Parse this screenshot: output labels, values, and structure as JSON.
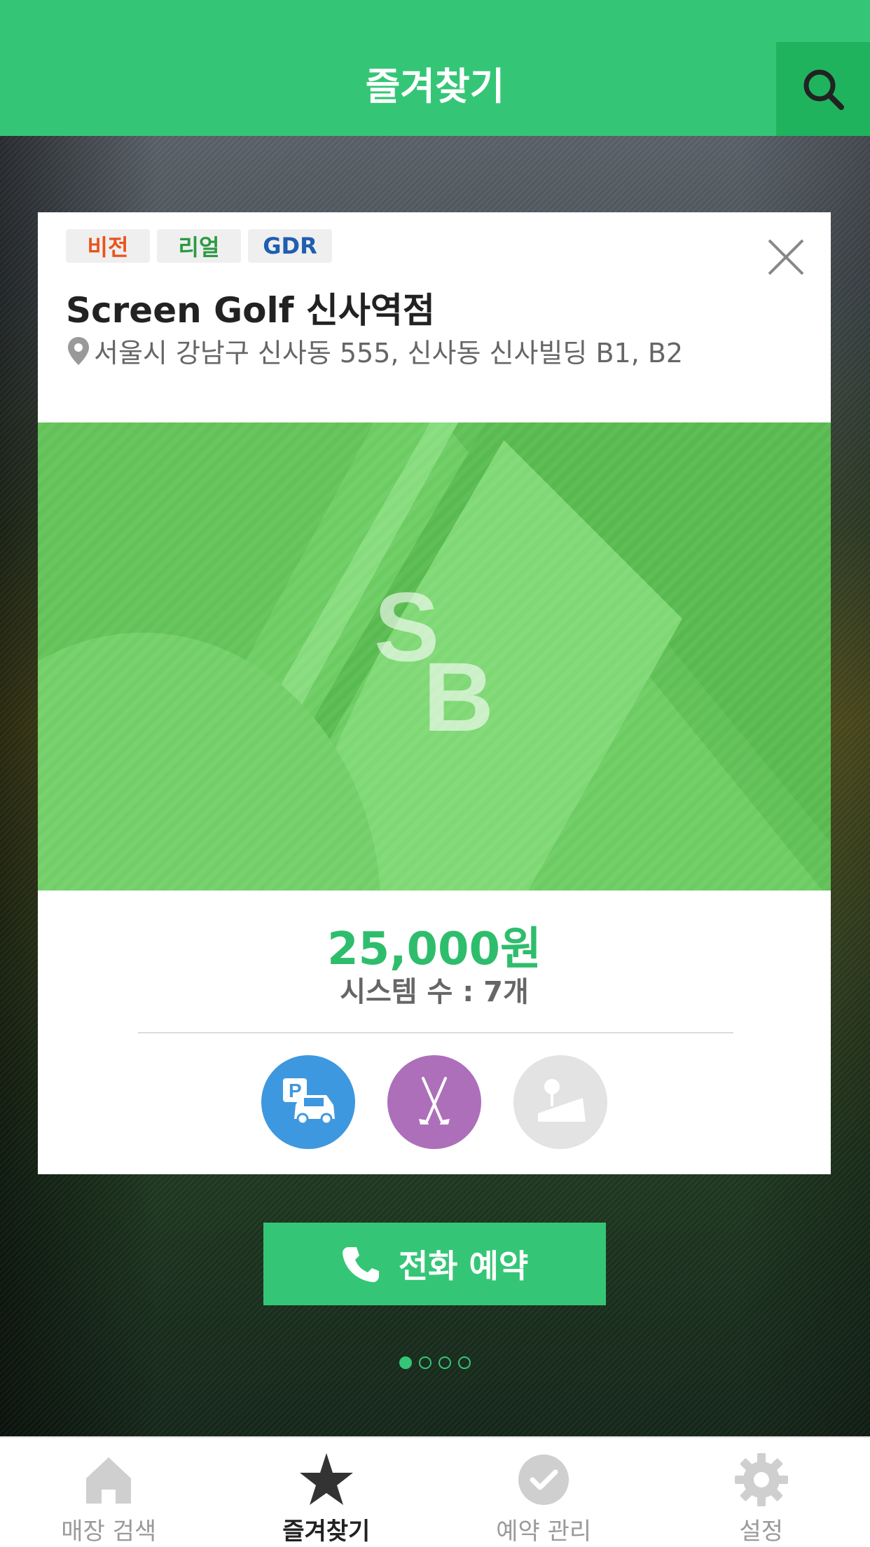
{
  "header": {
    "title": "즐겨찾기",
    "search_icon": "search-icon"
  },
  "store": {
    "tags": [
      "비전",
      "리얼",
      "GDR"
    ],
    "name": "Screen Golf 신사역점",
    "address": "서울시 강남구 신사동 555, 신사동 신사빌딩 B1, B2",
    "image_logo": "SB",
    "price": "25,000원",
    "systems": "시스템 수 : 7개",
    "facilities": [
      "parking-icon",
      "golf-clubs-icon",
      "tee-icon"
    ]
  },
  "call_button": {
    "label": "전화 예약"
  },
  "pager": {
    "count": 4,
    "active": 1
  },
  "tabs": [
    {
      "label": "매장 검색",
      "icon": "home-icon"
    },
    {
      "label": "즐겨찾기",
      "icon": "star-icon",
      "active": true
    },
    {
      "label": "예약 관리",
      "icon": "check-circle-icon"
    },
    {
      "label": "설정",
      "icon": "gear-icon"
    }
  ],
  "colors": {
    "accent": "#34c676",
    "parking": "#3e98df",
    "clubs": "#ad6fba",
    "tee": "#e3e3e3"
  }
}
